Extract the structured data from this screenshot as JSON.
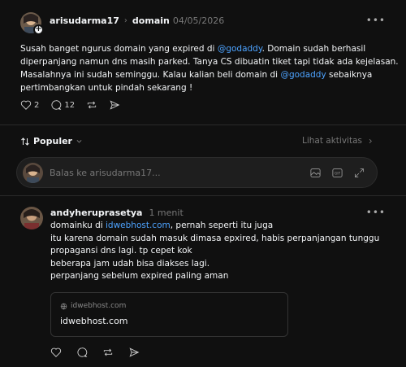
{
  "post": {
    "username": "arisudarma17",
    "separator": "›",
    "topic": "domain",
    "date": "04/05/2026",
    "more": "•••",
    "lines": [
      {
        "pre": "Susah banget ngurus domain yang expired di ",
        "mention": "@godaddy",
        "post": ". Domain sudah berhasil"
      },
      {
        "pre": "diperpanjang namun dns masih parked. Tanya CS dibuatin tiket tapi tidak ada kejelasan.",
        "mention": "",
        "post": ""
      },
      {
        "pre": "Masalahnya ini sudah seminggu. Kalau kalian beli domain di ",
        "mention": "@godaddy",
        "post": " sebaiknya"
      },
      {
        "pre": "pertimbangkan untuk pindah sekarang !",
        "mention": "",
        "post": ""
      }
    ],
    "likes": "2",
    "comments": "12"
  },
  "sort": {
    "label": "Populer",
    "activity_label": "Lihat aktivitas"
  },
  "reply_box": {
    "placeholder": "Balas ke arisudarma17..."
  },
  "reply": {
    "username": "andyheruprasetya",
    "time": "1 menit",
    "more": "•••",
    "line1_pre": "domainku di ",
    "line1_link": "idwebhost.com",
    "line1_post": ", pernah seperti itu juga",
    "line2": "itu karena domain sudah masuk dimasa epxired, habis perpanjangan tunggu",
    "line3": "propagansi dns lagi. tp cepet kok",
    "line4": "beberapa jam udah bisa diakses lagi.",
    "line5": "perpanjang sebelum expired paling aman",
    "preview_domain": "idwebhost.com",
    "preview_title": "idwebhost.com"
  },
  "colors": {
    "background": "#101010",
    "link": "#4da3ff",
    "muted": "#777777"
  }
}
